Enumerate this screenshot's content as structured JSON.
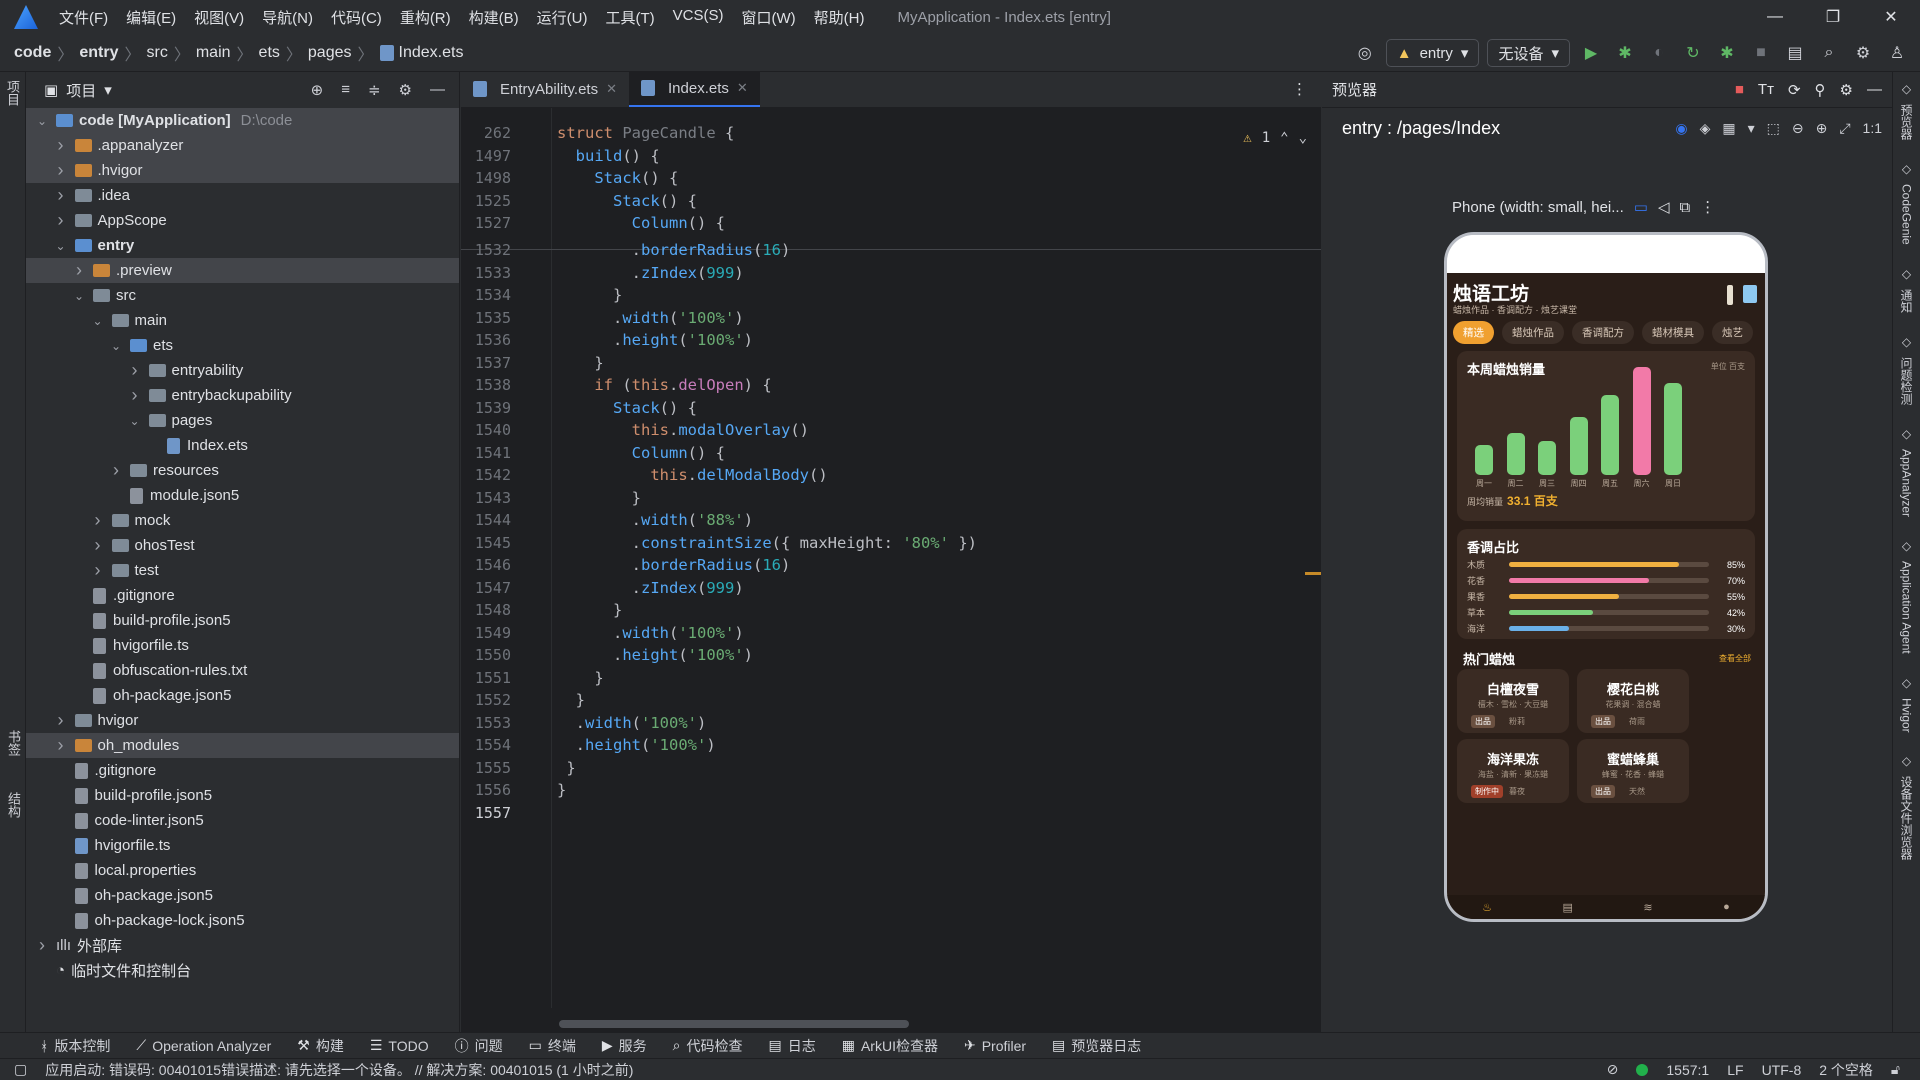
{
  "app": {
    "title": "MyApplication - Index.ets [entry]"
  },
  "menu": [
    "文件(F)",
    "编辑(E)",
    "视图(V)",
    "导航(N)",
    "代码(C)",
    "重构(R)",
    "构建(B)",
    "运行(U)",
    "工具(T)",
    "VCS(S)",
    "窗口(W)",
    "帮助(H)"
  ],
  "window_controls": {
    "min": "—",
    "max": "❐",
    "close": "✕"
  },
  "breadcrumbs": [
    "code",
    "entry",
    "src",
    "main",
    "ets",
    "pages",
    "Index.ets"
  ],
  "run": {
    "module": "entry",
    "device": "无设备"
  },
  "left_strip": {
    "project": "项目",
    "bookmarks": "书签",
    "structure": "结构"
  },
  "project_panel": {
    "title": "项目",
    "tree": [
      {
        "label": "code [MyApplication]",
        "path": "D:\\code",
        "depth": 0,
        "type": "folder-blue",
        "arrow": "v",
        "hl": true,
        "bold": true
      },
      {
        "label": ".appanalyzer",
        "depth": 1,
        "type": "folder-org",
        "arrow": ">",
        "hl": true
      },
      {
        "label": ".hvigor",
        "depth": 1,
        "type": "folder-org",
        "arrow": ">",
        "hl": true
      },
      {
        "label": ".idea",
        "depth": 1,
        "type": "folder",
        "arrow": ">"
      },
      {
        "label": "AppScope",
        "depth": 1,
        "type": "folder",
        "arrow": ">"
      },
      {
        "label": "entry",
        "depth": 1,
        "type": "folder-blue",
        "arrow": "v",
        "bold": true
      },
      {
        "label": ".preview",
        "depth": 2,
        "type": "folder-org",
        "arrow": ">",
        "hl": true
      },
      {
        "label": "src",
        "depth": 2,
        "type": "folder",
        "arrow": "v"
      },
      {
        "label": "main",
        "depth": 3,
        "type": "folder",
        "arrow": "v"
      },
      {
        "label": "ets",
        "depth": 4,
        "type": "folder-blue",
        "arrow": "v"
      },
      {
        "label": "entryability",
        "depth": 5,
        "type": "folder",
        "arrow": ">"
      },
      {
        "label": "entrybackupability",
        "depth": 5,
        "type": "folder",
        "arrow": ">"
      },
      {
        "label": "pages",
        "depth": 5,
        "type": "folder",
        "arrow": "v"
      },
      {
        "label": "Index.ets",
        "depth": 6,
        "type": "file-ts",
        "arrow": ""
      },
      {
        "label": "resources",
        "depth": 4,
        "type": "folder",
        "arrow": ">"
      },
      {
        "label": "module.json5",
        "depth": 4,
        "type": "file",
        "arrow": ""
      },
      {
        "label": "mock",
        "depth": 3,
        "type": "folder",
        "arrow": ">"
      },
      {
        "label": "ohosTest",
        "depth": 3,
        "type": "folder",
        "arrow": ">"
      },
      {
        "label": "test",
        "depth": 3,
        "type": "folder",
        "arrow": ">"
      },
      {
        "label": ".gitignore",
        "depth": 2,
        "type": "file",
        "arrow": ""
      },
      {
        "label": "build-profile.json5",
        "depth": 2,
        "type": "file",
        "arrow": ""
      },
      {
        "label": "hvigorfile.ts",
        "depth": 2,
        "type": "file",
        "arrow": ""
      },
      {
        "label": "obfuscation-rules.txt",
        "depth": 2,
        "type": "file",
        "arrow": ""
      },
      {
        "label": "oh-package.json5",
        "depth": 2,
        "type": "file",
        "arrow": ""
      },
      {
        "label": "hvigor",
        "depth": 1,
        "type": "folder",
        "arrow": ">"
      },
      {
        "label": "oh_modules",
        "depth": 1,
        "type": "folder-org",
        "arrow": ">",
        "hl": true
      },
      {
        "label": ".gitignore",
        "depth": 1,
        "type": "file",
        "arrow": ""
      },
      {
        "label": "build-profile.json5",
        "depth": 1,
        "type": "file",
        "arrow": ""
      },
      {
        "label": "code-linter.json5",
        "depth": 1,
        "type": "file",
        "arrow": ""
      },
      {
        "label": "hvigorfile.ts",
        "depth": 1,
        "type": "file-ts",
        "arrow": ""
      },
      {
        "label": "local.properties",
        "depth": 1,
        "type": "file",
        "arrow": ""
      },
      {
        "label": "oh-package.json5",
        "depth": 1,
        "type": "file",
        "arrow": ""
      },
      {
        "label": "oh-package-lock.json5",
        "depth": 1,
        "type": "file",
        "arrow": ""
      },
      {
        "label": "外部库",
        "depth": 0,
        "type": "lib",
        "arrow": ">"
      },
      {
        "label": "临时文件和控制台",
        "depth": 0,
        "type": "scratch",
        "arrow": ""
      }
    ]
  },
  "editor": {
    "tabs": [
      {
        "label": "EntryAbility.ets",
        "active": false
      },
      {
        "label": "Index.ets",
        "active": true
      }
    ],
    "warnings": "1",
    "lines": [
      {
        "n": "262",
        "html": "<span class=\"kw\">struct</span> <span class=\"dim\">PageCandle</span> {"
      },
      {
        "n": "1497",
        "html": "  <span class=\"fn\">build</span>() {"
      },
      {
        "n": "1498",
        "html": "    <span class=\"fn\">Stack</span>() {"
      },
      {
        "n": "1525",
        "html": "      <span class=\"fn\">Stack</span>() {"
      },
      {
        "n": "1527",
        "html": "        <span class=\"fn\">Column</span>() {"
      },
      {
        "n": "1532",
        "html": "        .<span class=\"fn\">borderRadius</span>(<span class=\"nm\">16</span>)"
      },
      {
        "n": "1533",
        "html": "        .<span class=\"fn\">zIndex</span>(<span class=\"nm\">999</span>)"
      },
      {
        "n": "1534",
        "html": "      }"
      },
      {
        "n": "1535",
        "html": "      .<span class=\"fn\">width</span>(<span class=\"st\">'100%'</span>)"
      },
      {
        "n": "1536",
        "html": "      .<span class=\"fn\">height</span>(<span class=\"st\">'100%'</span>)"
      },
      {
        "n": "1537",
        "html": "    }"
      },
      {
        "n": "1538",
        "html": "    <span class=\"kw\">if</span> (<span class=\"kw\">this</span>.<span class=\"pp\">delOpen</span>) {"
      },
      {
        "n": "1539",
        "html": "      <span class=\"fn\">Stack</span>() {"
      },
      {
        "n": "1540",
        "html": "        <span class=\"kw\">this</span>.<span class=\"fn\">modalOverlay</span>()"
      },
      {
        "n": "1541",
        "html": "        <span class=\"fn\">Column</span>() {"
      },
      {
        "n": "1542",
        "html": "          <span class=\"kw\">this</span>.<span class=\"fn\">delModalBody</span>()"
      },
      {
        "n": "1543",
        "html": "        }"
      },
      {
        "n": "1544",
        "html": "        .<span class=\"fn\">width</span>(<span class=\"st\">'88%'</span>)"
      },
      {
        "n": "1545",
        "html": "        .<span class=\"fn\">constraintSize</span>({ maxHeight: <span class=\"st\">'80%'</span> })"
      },
      {
        "n": "1546",
        "html": "        .<span class=\"fn\">borderRadius</span>(<span class=\"nm\">16</span>)"
      },
      {
        "n": "1547",
        "html": "        .<span class=\"fn\">zIndex</span>(<span class=\"nm\">999</span>)"
      },
      {
        "n": "1548",
        "html": "      }"
      },
      {
        "n": "1549",
        "html": "      .<span class=\"fn\">width</span>(<span class=\"st\">'100%'</span>)"
      },
      {
        "n": "1550",
        "html": "      .<span class=\"fn\">height</span>(<span class=\"st\">'100%'</span>)"
      },
      {
        "n": "1551",
        "html": "    }"
      },
      {
        "n": "1552",
        "html": "  }"
      },
      {
        "n": "1553",
        "html": "  .<span class=\"fn\">width</span>(<span class=\"st\">'100%'</span>)"
      },
      {
        "n": "1554",
        "html": "  .<span class=\"fn\">height</span>(<span class=\"st\">'100%'</span>)"
      },
      {
        "n": "1555",
        "html": " }"
      },
      {
        "n": "1556",
        "html": "}"
      },
      {
        "n": "1557",
        "html": ""
      }
    ]
  },
  "preview": {
    "title": "预览器",
    "route": "entry : /pages/Index",
    "device": "Phone (width: small, hei...",
    "app": {
      "title": "烛语工坊",
      "subtitle": "蜡烛作品 · 香调配方 · 烛艺课堂",
      "categories": [
        {
          "label": "精选",
          "on": true
        },
        {
          "label": "蜡烛作品"
        },
        {
          "label": "香调配方"
        },
        {
          "label": "蜡材模具"
        },
        {
          "label": "烛艺"
        }
      ],
      "sales": {
        "title": "本周蜡烛销量",
        "unit": "单位 百支",
        "days": [
          {
            "label": "周一",
            "v": 3.0
          },
          {
            "label": "周二",
            "v": 4.2
          },
          {
            "label": "周三",
            "v": 3.4
          },
          {
            "label": "周四",
            "v": 5.8
          },
          {
            "label": "周五",
            "v": 8.0
          },
          {
            "label": "周六",
            "v": 10.8
          },
          {
            "label": "周日",
            "v": 9.2
          }
        ],
        "highlight_index": 5,
        "total_label": "周均销量",
        "total_value": "33.1 百支"
      },
      "scents": {
        "title": "香调占比",
        "items": [
          {
            "name": "木质",
            "pct": 85,
            "label": "85%",
            "color": "#f0b040"
          },
          {
            "name": "花香",
            "pct": 70,
            "label": "70%",
            "color": "#f27aa8"
          },
          {
            "name": "果香",
            "pct": 55,
            "label": "55%",
            "color": "#f0b040"
          },
          {
            "name": "草本",
            "pct": 42,
            "label": "42%",
            "color": "#7bd07b"
          },
          {
            "name": "海洋",
            "pct": 30,
            "label": "30%",
            "color": "#6ab0e8"
          }
        ]
      },
      "hot": {
        "title": "热门蜡烛",
        "more": "查看全部",
        "items": [
          {
            "name": "白檀夜雪",
            "desc": "檀木 · 雪松 · 大豆蜡",
            "badge": "出品",
            "other": "粉莉"
          },
          {
            "name": "樱花白桃",
            "desc": "花果调 · 混合蜡",
            "badge": "出品",
            "other": "荷雨"
          },
          {
            "name": "海洋果冻",
            "desc": "海盐 · 清新 · 果冻蜡",
            "badge": "制作中",
            "other": "暮夜"
          },
          {
            "name": "蜜蜡蜂巢",
            "desc": "蜂蜜 · 花香 · 蜂蜡",
            "badge": "出品",
            "other": "天然"
          }
        ]
      }
    }
  },
  "right_strip": [
    "预览器",
    "CodeGenie",
    "通知",
    "问题检测",
    "AppAnalyzer",
    "Application Agent",
    "Hvigor",
    "设备文件浏览器"
  ],
  "bottom_tools": [
    "版本控制",
    "Operation Analyzer",
    "构建",
    "TODO",
    "问题",
    "终端",
    "服务",
    "代码检查",
    "日志",
    "ArkUI检查器",
    "Profiler",
    "预览器日志"
  ],
  "status": {
    "message": "应用启动: 错误码: 00401015错误描述: 请先选择一个设备。 // 解决方案: 00401015 (1 小时之前)",
    "position": "1557:1",
    "line_sep": "LF",
    "encoding": "UTF-8",
    "indent": "2 个空格"
  }
}
